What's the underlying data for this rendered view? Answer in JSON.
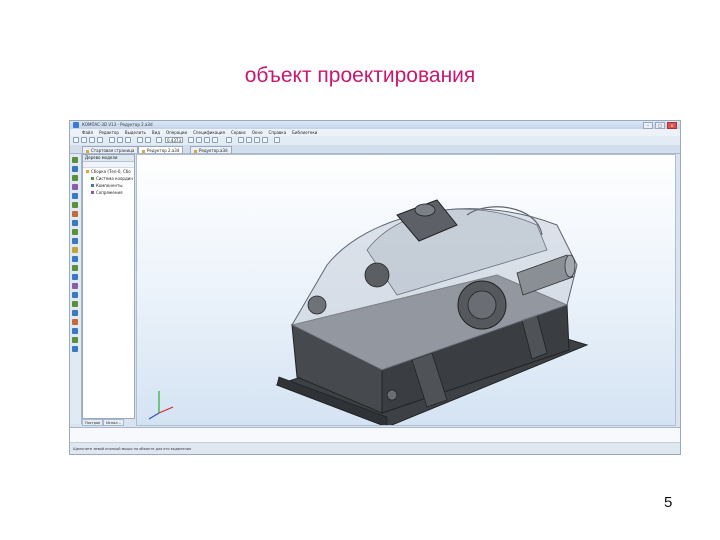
{
  "slide": {
    "title": "объект проектирования",
    "page_number": "5"
  },
  "window": {
    "title": "КОМПАС-3D V13 - Редуктор 2.a3d",
    "controls": [
      "–",
      "□",
      "×"
    ]
  },
  "menu": {
    "items": [
      "Файл",
      "Редактор",
      "Выделить",
      "Вид",
      "Операции",
      "Спецификация",
      "Сервис",
      "Окно",
      "Справка",
      "Библиотеки"
    ]
  },
  "toolbar": {
    "scale_value": "0.4373"
  },
  "tabs": [
    {
      "label": "Стартовая страница"
    },
    {
      "label": "Редуктор 2.a3d"
    },
    {
      "label": "Редуктор.a3d"
    }
  ],
  "tree": {
    "header": "Дерево модели",
    "items": [
      {
        "label": "Сборка (Тел-0, Сбо"
      },
      {
        "label": "Система координ"
      },
      {
        "label": "Компоненты"
      },
      {
        "label": "Сопряжения"
      }
    ],
    "bottom_tabs": [
      "Построе",
      "Испол..."
    ]
  },
  "status": {
    "text": "Щелкните левой кнопкой мыши на объекте для его выделения"
  },
  "colors": {
    "title_color": "#c8186e",
    "viewport_top": "#ffffff",
    "viewport_bottom": "#d4e3f3",
    "model_body": "#4a4d52"
  }
}
